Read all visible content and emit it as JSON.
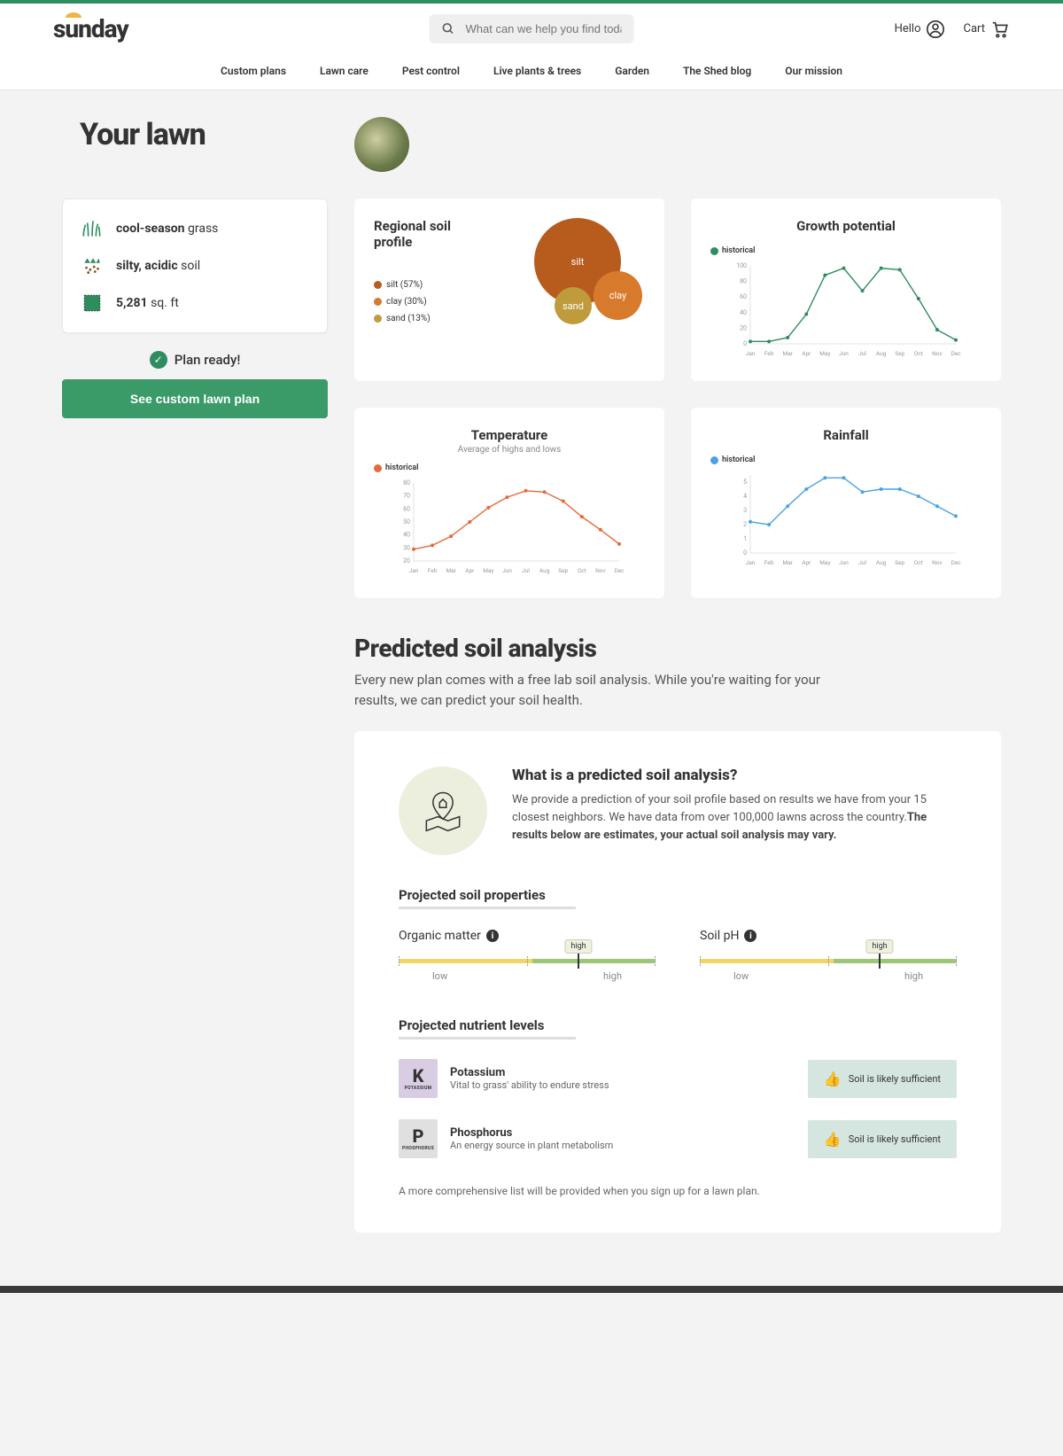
{
  "header": {
    "logo": "sunday",
    "search_placeholder": "What can we help you find today?",
    "hello": "Hello",
    "cart": "Cart",
    "nav": [
      "Custom plans",
      "Lawn care",
      "Pest control",
      "Live plants & trees",
      "Garden",
      "The Shed blog",
      "Our mission"
    ]
  },
  "page_title": "Your lawn",
  "lawn": {
    "grass_type_bold": "cool-season",
    "grass_type_rest": "grass",
    "soil_bold": "silty, acidic",
    "soil_rest": "soil",
    "area_bold": "5,281",
    "area_rest": "sq. ft"
  },
  "plan_ready": "Plan ready!",
  "cta": "See custom lawn plan",
  "soil_profile": {
    "title": "Regional soil profile",
    "legend_silt": "silt (57%)",
    "legend_clay": "clay (30%)",
    "legend_sand": "sand (13%)",
    "label_silt": "silt",
    "label_clay": "clay",
    "label_sand": "sand"
  },
  "growth": {
    "title": "Growth potential",
    "legend": "historical"
  },
  "temperature": {
    "title": "Temperature",
    "sub": "Average of highs and lows",
    "legend": "historical"
  },
  "rainfall": {
    "title": "Rainfall",
    "legend": "historical"
  },
  "analysis": {
    "heading": "Predicted soil analysis",
    "desc": "Every new plan comes with a free lab soil analysis. While you're waiting for your results, we can predict your soil health.",
    "what_h": "What is a predicted soil analysis?",
    "what_p": "We provide a prediction of your soil profile based on results we have from your 15 closest neighbors. We have data from over 100,000 lawns across the country.",
    "what_strong": "The results below are estimates, your actual soil analysis may vary.",
    "props_h": "Projected soil properties",
    "prop1": "Organic matter",
    "prop2": "Soil pH",
    "gauge_val": "high",
    "gauge_low": "low",
    "gauge_high": "high",
    "nutr_h": "Projected nutrient levels",
    "nutr1": {
      "sym": "K",
      "tile_label": "Potassium",
      "name": "Potassium",
      "desc": "Vital to grass' ability to endure stress",
      "status": "Soil is likely sufficient"
    },
    "nutr2": {
      "sym": "P",
      "tile_label": "Phosphorus",
      "name": "Phosphorus",
      "desc": "An energy source in plant metabolism",
      "status": "Soil is likely sufficient"
    },
    "footnote": "A more comprehensive list will be provided when you sign up for a lawn plan."
  },
  "colors": {
    "silt": "#b85c1e",
    "clay": "#d87a2b",
    "sand": "#bf9b3c",
    "growth": "#2e8d5f",
    "temp": "#e46a3d",
    "rain": "#4aa3e0"
  },
  "chart_data": [
    {
      "type": "bubble",
      "title": "Regional soil profile",
      "series": [
        {
          "name": "silt",
          "value": 57
        },
        {
          "name": "clay",
          "value": 30
        },
        {
          "name": "sand",
          "value": 13
        }
      ]
    },
    {
      "type": "line",
      "title": "Growth potential",
      "ylim": [
        0,
        100
      ],
      "yticks": [
        0,
        20,
        40,
        60,
        80,
        100
      ],
      "ylabel": "",
      "categories": [
        "Jan",
        "Feb",
        "Mar",
        "Apr",
        "May",
        "Jun",
        "Jul",
        "Aug",
        "Sep",
        "Oct",
        "Nov",
        "Dec"
      ],
      "series": [
        {
          "name": "historical",
          "values": [
            3,
            3,
            8,
            38,
            88,
            97,
            68,
            97,
            95,
            58,
            18,
            5
          ]
        }
      ]
    },
    {
      "type": "line",
      "title": "Temperature",
      "subtitle": "Average of highs and lows",
      "ylim": [
        20,
        80
      ],
      "yticks": [
        20,
        30,
        40,
        50,
        60,
        70,
        80
      ],
      "ylabel": "",
      "categories": [
        "Jan",
        "Feb",
        "Mar",
        "Apr",
        "May",
        "Jun",
        "Jul",
        "Aug",
        "Sep",
        "Oct",
        "Nov",
        "Dec"
      ],
      "series": [
        {
          "name": "historical",
          "values": [
            29,
            32,
            39,
            50,
            61,
            69,
            74,
            73,
            66,
            54,
            44,
            33
          ]
        }
      ]
    },
    {
      "type": "line",
      "title": "Rainfall",
      "ylim": [
        0,
        5.5
      ],
      "yticks": [
        0,
        1,
        2,
        3,
        4,
        5
      ],
      "ylabel": "",
      "categories": [
        "Jan",
        "Feb",
        "Mar",
        "Apr",
        "May",
        "Jun",
        "Jul",
        "Aug",
        "Sep",
        "Oct",
        "Nov",
        "Dec"
      ],
      "series": [
        {
          "name": "historical",
          "values": [
            2.2,
            2.0,
            3.3,
            4.5,
            5.3,
            5.3,
            4.3,
            4.5,
            4.5,
            4.0,
            3.3,
            2.6
          ]
        }
      ]
    }
  ]
}
